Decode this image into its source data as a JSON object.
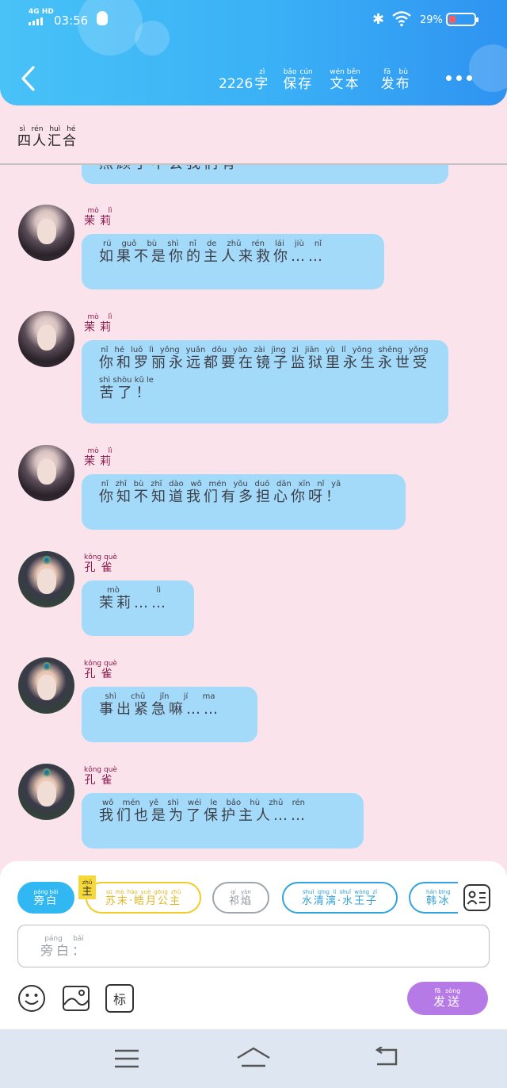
{
  "status_bar": {
    "network": "4G HD",
    "time": "03:56",
    "battery": "29%"
  },
  "header": {
    "word_count": "2226",
    "items": [
      {
        "label": "字",
        "pinyin": "zì"
      },
      {
        "label": "保存",
        "pinyin": "bǎo cún"
      },
      {
        "label": "文本",
        "pinyin": "wén běn"
      },
      {
        "label": "发布",
        "pinyin": "fā bù"
      }
    ]
  },
  "chapter": {
    "title": "四人汇合",
    "pinyin": "sì rén huì hé"
  },
  "messages": [
    {
      "speaker": "茉莉",
      "speaker_pinyin": "mò lì",
      "text": "如果不是你的主人来救你……",
      "pinyin": "rú guǒ bù shì nǐ de zhǔ rén lái jiù nǐ"
    },
    {
      "speaker": "茉莉",
      "speaker_pinyin": "mò lì",
      "text": "你和罗丽永远都要在镜子监狱里永生永世受苦了！",
      "pinyin": "nǐ hé luō lì yǒng yuǎn dōu yào zài jìng zi jiān yù lǐ yǒng shēng yǒng shì shòu kǔ le"
    },
    {
      "speaker": "茉莉",
      "speaker_pinyin": "mò lì",
      "text": "你知不知道我们有多担心你呀！",
      "pinyin": "nǐ zhī bù zhī dào wǒ mén yǒu duō dān xīn nǐ yā"
    },
    {
      "speaker": "孔雀",
      "speaker_pinyin": "kǒng què",
      "text": "茉莉……",
      "pinyin": "mò lì"
    },
    {
      "speaker": "孔雀",
      "speaker_pinyin": "kǒng què",
      "text": "事出紧急嘛……",
      "pinyin": "shì chū jǐn jí ma"
    },
    {
      "speaker": "孔雀",
      "speaker_pinyin": "kǒng què",
      "text": "我们也是为了保护主人……",
      "pinyin": "wǒ mén yě shì wéi le bǎo hù zhǔ rén"
    }
  ],
  "characters": [
    {
      "label": "旁白",
      "pinyin": "páng bái"
    },
    {
      "label": "主",
      "pinyin": "zhǔ"
    },
    {
      "label": "苏末·皓月公主",
      "pinyin": "sū mò hào yuè gōng zhǔ"
    },
    {
      "label": "祁焰",
      "pinyin": "qí yàn"
    },
    {
      "label": "水清漓·水王子",
      "pinyin": "shuǐ qīng lí shuǐ wáng zǐ"
    },
    {
      "label": "韩冰",
      "pinyin": "hán bīng"
    }
  ],
  "input": {
    "placeholder": "旁白：",
    "placeholder_pinyin": "páng bái"
  },
  "tag_button": "标",
  "send_button": {
    "label": "发送",
    "pinyin": "fā sòng"
  },
  "colors": {
    "header": "#3ab0f6",
    "bubble": "#a4daf9",
    "background": "#fbe3ec",
    "send": "#b67ae6",
    "speaker_name": "#8b1a4d"
  }
}
